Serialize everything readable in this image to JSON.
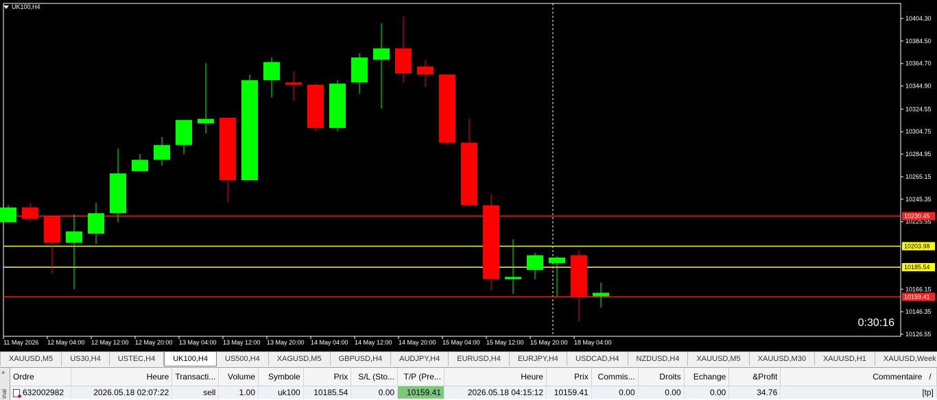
{
  "chart": {
    "symbol_label": "UK100,H4",
    "timer": "0:30:16",
    "price_scale": [
      "10404.30",
      "10384.50",
      "10364.70",
      "10344.90",
      "10324.55",
      "10304.75",
      "10284.95",
      "10265.15",
      "10245.35",
      "10225.55",
      "10166.15",
      "10146.35",
      "10126.55"
    ],
    "time_scale": [
      "11 May 2026",
      "12 May 04:00",
      "12 May 12:00",
      "12 May 20:00",
      "13 May 04:00",
      "13 May 12:00",
      "13 May 20:00",
      "14 May 04:00",
      "14 May 12:00",
      "14 May 20:00",
      "15 May 04:00",
      "15 May 12:00",
      "15 May 20:00",
      "18 May 04:00"
    ],
    "levels": [
      {
        "label": "10230.45",
        "color": "#ff2020",
        "value": 10230.45,
        "tag_bg": "#ff2020",
        "tag_fg": "#ffffff"
      },
      {
        "label": "10203.98",
        "color": "#ffff00",
        "value": 10203.98,
        "tag_bg": "#ffff00",
        "tag_fg": "#000000"
      },
      {
        "label": "10185.54",
        "color": "#ffff00",
        "value": 10185.54,
        "tag_bg": "#ffff00",
        "tag_fg": "#000000"
      },
      {
        "label": "10159.41",
        "color": "#ff2020",
        "value": 10159.41,
        "tag_bg": "#ff2020",
        "tag_fg": "#ffffff"
      }
    ],
    "colors": {
      "bull": "#00ff00",
      "bear": "#ff0000",
      "background": "#000000"
    }
  },
  "chart_data": {
    "type": "candlestick",
    "symbol": "UK100",
    "timeframe": "H4",
    "candles": [
      {
        "o": 10225,
        "h": 10240,
        "l": 10225,
        "c": 10238
      },
      {
        "o": 10238,
        "h": 10242,
        "l": 10225,
        "c": 10228
      },
      {
        "o": 10230,
        "h": 10230,
        "l": 10180,
        "c": 10207
      },
      {
        "o": 10207,
        "h": 10232,
        "l": 10166,
        "c": 10217
      },
      {
        "o": 10215,
        "h": 10242,
        "l": 10206,
        "c": 10233
      },
      {
        "o": 10233,
        "h": 10290,
        "l": 10225,
        "c": 10268
      },
      {
        "o": 10270,
        "h": 10285,
        "l": 10270,
        "c": 10280
      },
      {
        "o": 10280,
        "h": 10300,
        "l": 10275,
        "c": 10293
      },
      {
        "o": 10293,
        "h": 10310,
        "l": 10285,
        "c": 10315
      },
      {
        "o": 10312,
        "h": 10365,
        "l": 10303,
        "c": 10316
      },
      {
        "o": 10317,
        "h": 10317,
        "l": 10243,
        "c": 10262
      },
      {
        "o": 10262,
        "h": 10355,
        "l": 10262,
        "c": 10350
      },
      {
        "o": 10350,
        "h": 10370,
        "l": 10335,
        "c": 10366
      },
      {
        "o": 10348,
        "h": 10358,
        "l": 10332,
        "c": 10346
      },
      {
        "o": 10346,
        "h": 10347,
        "l": 10305,
        "c": 10308
      },
      {
        "o": 10308,
        "h": 10350,
        "l": 10305,
        "c": 10347
      },
      {
        "o": 10348,
        "h": 10374,
        "l": 10338,
        "c": 10370
      },
      {
        "o": 10368,
        "h": 10400,
        "l": 10325,
        "c": 10378
      },
      {
        "o": 10378,
        "h": 10406,
        "l": 10348,
        "c": 10356
      },
      {
        "o": 10362,
        "h": 10368,
        "l": 10344,
        "c": 10355
      },
      {
        "o": 10355,
        "h": 10355,
        "l": 10293,
        "c": 10295
      },
      {
        "o": 10295,
        "h": 10316,
        "l": 10240,
        "c": 10240
      },
      {
        "o": 10240,
        "h": 10250,
        "l": 10165,
        "c": 10175
      },
      {
        "o": 10175,
        "h": 10210,
        "l": 10162,
        "c": 10177
      },
      {
        "o": 10183,
        "h": 10198,
        "l": 10175,
        "c": 10196
      },
      {
        "o": 10189,
        "h": 10195,
        "l": 10160,
        "c": 10194
      },
      {
        "o": 10196,
        "h": 10200,
        "l": 10138,
        "c": 10160
      },
      {
        "o": 10160,
        "h": 10172,
        "l": 10150,
        "c": 10163
      }
    ],
    "ylim": [
      10120.0,
      10420.0
    ]
  },
  "tabs": [
    "XAUUSD,M5",
    "US30,H4",
    "USTEC,H4",
    "UK100,H4",
    "US500,H4",
    "XAGUSD,M5",
    "GBPUSD,H4",
    "AUDJPY,H4",
    "EURUSD,H4",
    "EURJPY,H4",
    "USDCAD,H4",
    "NZDUSD,H4",
    "XAUUSD,M5",
    "XAUUSD,M30",
    "XAUUSD,H1",
    "XAUUSD,Week"
  ],
  "active_tab": "UK100,H4",
  "terminal": {
    "side_label": "inal",
    "close_icon": "×",
    "columns": [
      "Ordre",
      "Heure",
      "Transacti...",
      "Volume",
      "Symbole",
      "Prix",
      "S/L (Sto...",
      "T/P (Pre...",
      "Heure",
      "Prix",
      "Commis...",
      "Droits",
      "Echange",
      "&Profit",
      "Commentaire"
    ],
    "row": {
      "order": "632002982",
      "time_open": "2026.05.18 02:07:22",
      "type": "sell",
      "volume": "1.00",
      "symbol": "uk100",
      "price_open": "10185.54",
      "sl": "0.00",
      "tp": "10159.41",
      "time_current": "2026.05.18 04:15:12",
      "price_current": "10159.41",
      "commission": "0.00",
      "swap_rights": "0.00",
      "exchange": "0.00",
      "profit": "34.76",
      "comment": "[tp]"
    },
    "sort_mark": "/"
  }
}
